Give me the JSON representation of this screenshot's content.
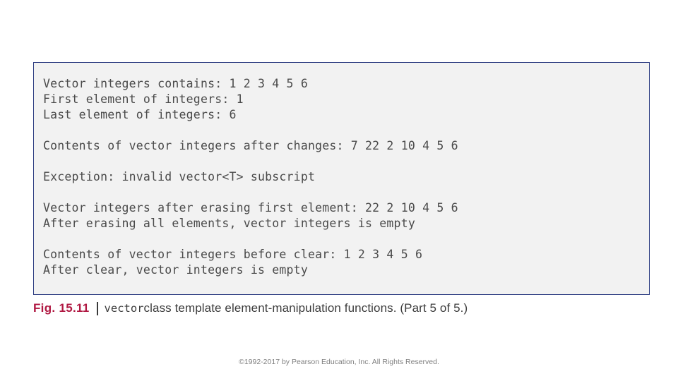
{
  "slide": {
    "output": {
      "lines": [
        "Vector integers contains: 1 2 3 4 5 6",
        "First element of integers: 1",
        "Last element of integers: 6",
        "",
        "Contents of vector integers after changes: 7 22 2 10 4 5 6",
        "",
        "Exception: invalid vector<T> subscript",
        "",
        "Vector integers after erasing first element: 22 2 10 4 5 6",
        "After erasing all elements, vector integers is empty",
        "",
        "Contents of vector integers before clear: 1 2 3 4 5 6",
        "After clear, vector integers is empty"
      ],
      "text": "Vector integers contains: 1 2 3 4 5 6\nFirst element of integers: 1\nLast element of integers: 6\n\nContents of vector integers after changes: 7 22 2 10 4 5 6\n\nException: invalid vector<T> subscript\n\nVector integers after erasing first element: 22 2 10 4 5 6\nAfter erasing all elements, vector integers is empty\n\nContents of vector integers before clear: 1 2 3 4 5 6\nAfter clear, vector integers is empty",
      "border_color": "#2a3a80",
      "background_color": "#f2f2f2",
      "text_color": "#4a4a4a"
    },
    "caption": {
      "figure_label": "Fig. 15.11",
      "separator": "|",
      "code_term": "vector",
      "description": " class template element-manipulation functions. (Part 5 of 5.)",
      "label_color": "#b01842"
    },
    "footer": {
      "copyright": "©1992-2017 by Pearson Education, Inc. All Rights Reserved."
    }
  }
}
